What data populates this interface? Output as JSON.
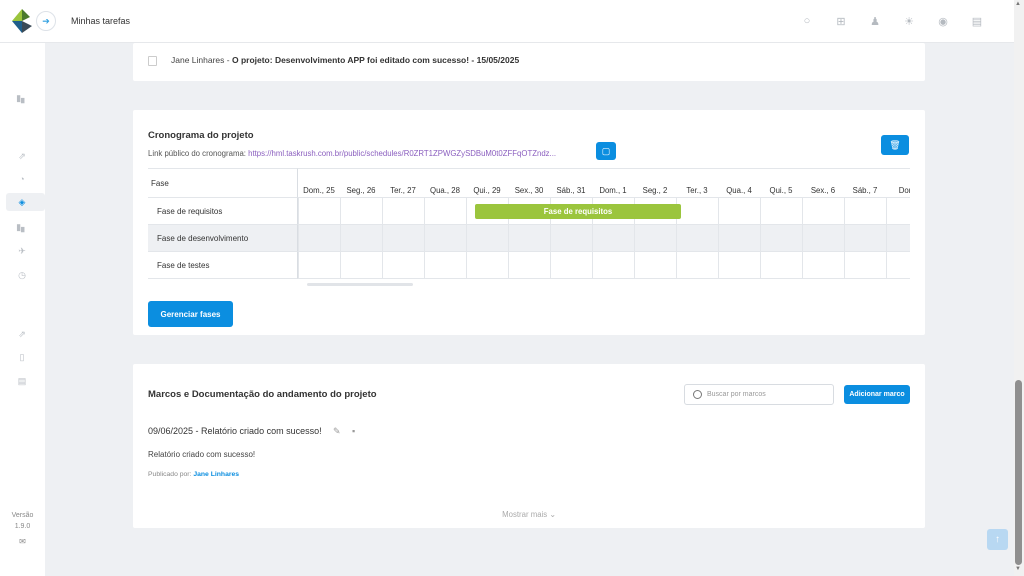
{
  "header": {
    "title": "Minhas tarefas",
    "icons": [
      "search-icon",
      "plus-icon",
      "user-icon",
      "sun-icon",
      "help-icon",
      "report-icon"
    ]
  },
  "sidebar": {
    "version_label": "Versão",
    "version": "1.9.0"
  },
  "notification": {
    "user": "Jane Linhares",
    "separator": " - ",
    "message": "O projeto: Desenvolvimento APP foi editado com sucesso! - 15/05/2025"
  },
  "schedule": {
    "title": "Cronograma do projeto",
    "link_label": "Link público do cronograma: ",
    "link_url": "https://hml.taskrush.com.br/public/schedules/R0ZRT1ZPWGZySDBuM0t0ZFFqOTZndz...",
    "phase_header": "Fase",
    "phases": [
      "Fase de requisitos",
      "Fase de desenvolvimento",
      "Fase de testes"
    ],
    "days": [
      "Dom., 25",
      "Seg., 26",
      "Ter., 27",
      "Qua., 28",
      "Qui., 29",
      "Sex., 30",
      "Sáb., 31",
      "Dom., 1",
      "Seg., 2",
      "Ter., 3",
      "Qua., 4",
      "Qui., 5",
      "Sex., 6",
      "Sáb., 7",
      "Dom"
    ],
    "bar_label": "Fase de requisitos",
    "manage_button": "Gerenciar fases"
  },
  "milestones": {
    "title": "Marcos e Documentação do andamento do projeto",
    "search_placeholder": "Buscar por marcos",
    "add_button": "Adicionar marco",
    "item_title": "09/06/2025 - Relatório criado com sucesso!",
    "item_desc": "Relatório criado com sucesso!",
    "published_label": "Publicado por: ",
    "published_by": "Jane Linhares",
    "show_more": "Mostrar mais ⌄"
  },
  "colors": {
    "primary": "#0b8ee0",
    "bar": "#9bc53d",
    "link": "#8b5fbf"
  }
}
